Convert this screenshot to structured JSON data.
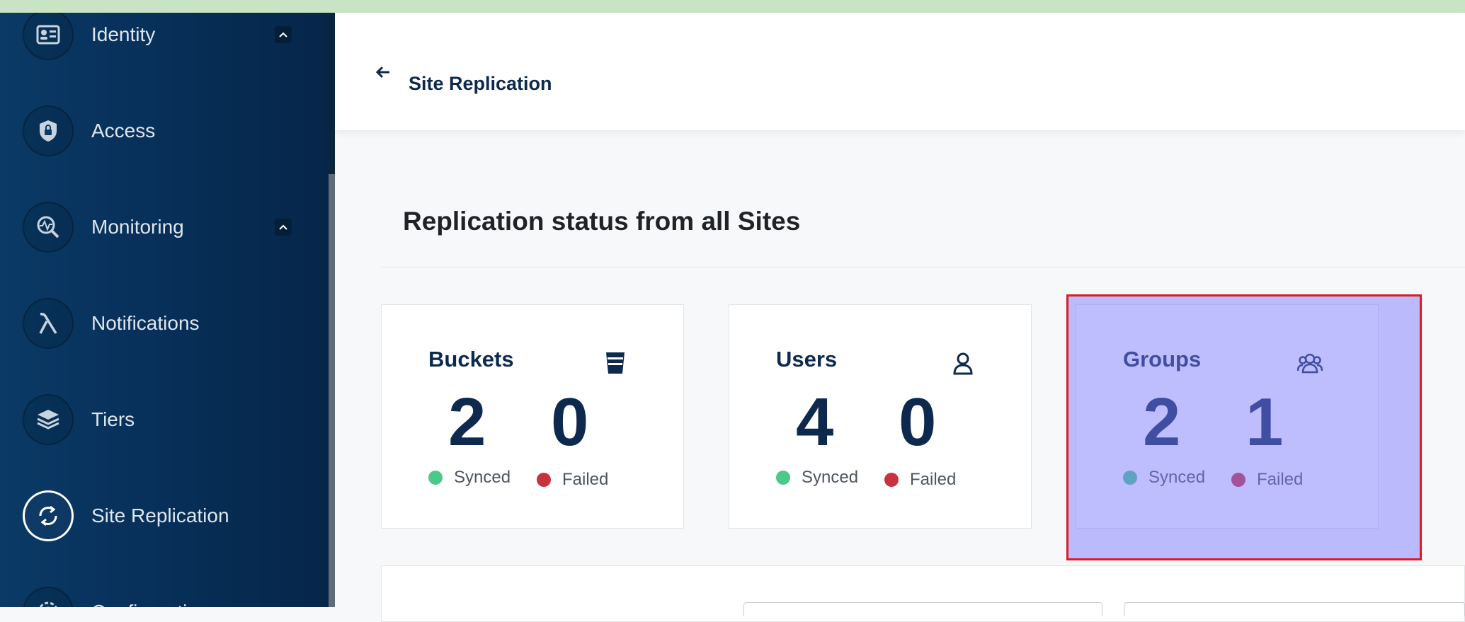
{
  "sidebar": {
    "items": [
      {
        "label": "Identity",
        "icon": "id-card-icon",
        "expanded": true
      },
      {
        "label": "Access",
        "icon": "shield-lock-icon"
      },
      {
        "label": "Monitoring",
        "icon": "monitoring-icon",
        "expanded": true
      },
      {
        "label": "Notifications",
        "icon": "lambda-icon"
      },
      {
        "label": "Tiers",
        "icon": "layers-icon"
      },
      {
        "label": "Site Replication",
        "icon": "sync-icon",
        "active": true
      },
      {
        "label": "Configurations",
        "icon": "gear-icon"
      }
    ]
  },
  "header": {
    "title": "Site Replication"
  },
  "main": {
    "section_title": "Replication status from all Sites",
    "cards": [
      {
        "title": "Buckets",
        "icon": "bucket-icon",
        "synced": "2",
        "failed": "0",
        "synced_label": "Synced",
        "failed_label": "Failed"
      },
      {
        "title": "Users",
        "icon": "user-icon",
        "synced": "4",
        "failed": "0",
        "synced_label": "Synced",
        "failed_label": "Failed"
      },
      {
        "title": "Groups",
        "icon": "group-icon",
        "synced": "2",
        "failed": "1",
        "synced_label": "Synced",
        "failed_label": "Failed"
      }
    ]
  },
  "colors": {
    "synced": "#4cc98a",
    "failed": "#c7323f",
    "navy": "#0d2a4e",
    "highlight_border": "#e01b24"
  }
}
